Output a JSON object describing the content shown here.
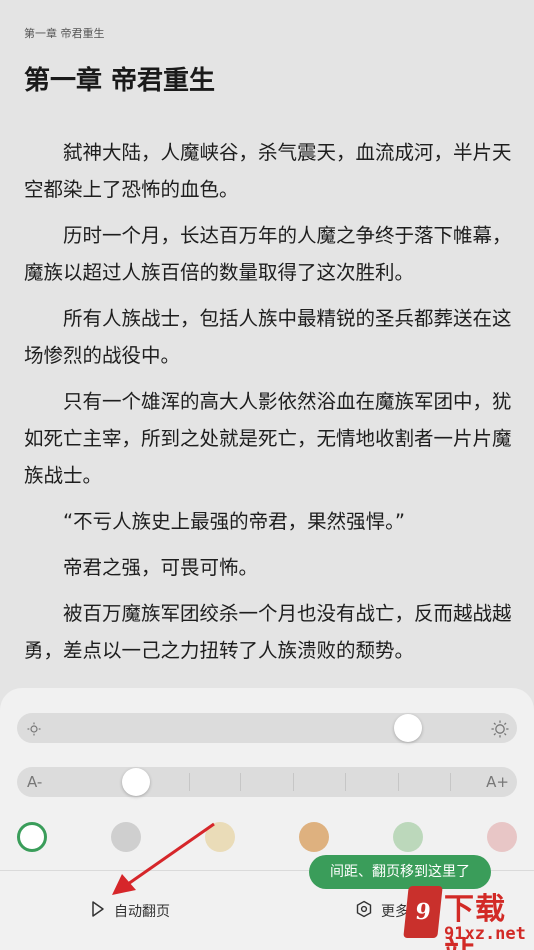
{
  "reader": {
    "running_header": "第一章 帝君重生",
    "chapter_title": "第一章 帝君重生",
    "paragraphs": [
      "弑神大陆，人魔峡谷，杀气震天，血流成河，半片天空都染上了恐怖的血色。",
      "历时一个月，长达百万年的人魔之争终于落下帷幕，魔族以超过人族百倍的数量取得了这次胜利。",
      "所有人族战士，包括人族中最精锐的圣兵都葬送在这场惨烈的战役中。",
      "只有一个雄浑的高大人影依然浴血在魔族军团中，犹如死亡主宰，所到之处就是死亡，无情地收割者一片片魔族战士。",
      "“不亏人族史上最强的帝君，果然强悍。”",
      "帝君之强，可畏可怖。",
      "被百万魔族军团绞杀一个月也没有战亡，反而越战越勇，差点以一己之力扭转了人族溃败的颓势。"
    ]
  },
  "panel": {
    "brightness": {
      "icon_left": "sun-small-icon",
      "icon_right": "sun-large-icon",
      "level": 0.78
    },
    "font_size": {
      "label_left": "A-",
      "label_right": "A+",
      "level": 0.24
    },
    "themes": [
      {
        "name": "theme-default",
        "color": "#ffffff",
        "selected": true,
        "ring": "#3a9d5a"
      },
      {
        "name": "theme-gray",
        "color": "#cfcfcf"
      },
      {
        "name": "theme-cream",
        "color": "#eadcb8"
      },
      {
        "name": "theme-tan",
        "color": "#deb17f"
      },
      {
        "name": "theme-green",
        "color": "#bcd8bb"
      },
      {
        "name": "theme-pink",
        "color": "#e8c6c6"
      }
    ],
    "auto_page_label": "自动翻页",
    "more_settings_label": "更多设置"
  },
  "toast": {
    "text": "间距、翻页移到这里了"
  },
  "watermark": {
    "brand": "下载站",
    "site": "91xz.net",
    "logo_char": "9"
  },
  "colors": {
    "accent": "#3a9d5a",
    "arrow": "#d6262a"
  }
}
